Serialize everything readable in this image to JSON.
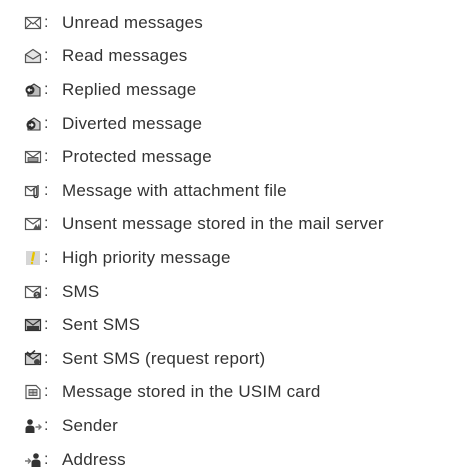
{
  "items": [
    {
      "icon": "unread-message-icon",
      "colon": ":",
      "label": "Unread messages"
    },
    {
      "icon": "read-message-icon",
      "colon": ":",
      "label": "Read messages"
    },
    {
      "icon": "replied-message-icon",
      "colon": ":",
      "label": "Replied message"
    },
    {
      "icon": "diverted-message-icon",
      "colon": ":",
      "label": "Diverted message"
    },
    {
      "icon": "protected-message-icon",
      "colon": ":",
      "label": "Protected message"
    },
    {
      "icon": "attachment-message-icon",
      "colon": ":",
      "label": "Message with attachment file"
    },
    {
      "icon": "unsent-server-message-icon",
      "colon": ":",
      "label": "Unsent message stored in the mail server"
    },
    {
      "icon": "high-priority-icon",
      "colon": ":",
      "label": "High priority message"
    },
    {
      "icon": "sms-icon",
      "colon": ":",
      "label": "SMS"
    },
    {
      "icon": "sent-sms-icon",
      "colon": ":",
      "label": "Sent SMS"
    },
    {
      "icon": "sent-sms-report-icon",
      "colon": ":",
      "label": "Sent SMS (request report)"
    },
    {
      "icon": "usim-message-icon",
      "colon": ":",
      "label": "Message stored in the USIM card"
    },
    {
      "icon": "sender-icon",
      "colon": ":",
      "label": "Sender"
    },
    {
      "icon": "address-icon",
      "colon": ":",
      "label": "Address"
    }
  ],
  "colors": {
    "text": "#333333",
    "icon_stroke": "#555555",
    "icon_dark": "#2f2f2f",
    "icon_gray": "#9a9a9a",
    "icon_light": "#d8d8d8",
    "priority_yellow": "#e8c400"
  }
}
